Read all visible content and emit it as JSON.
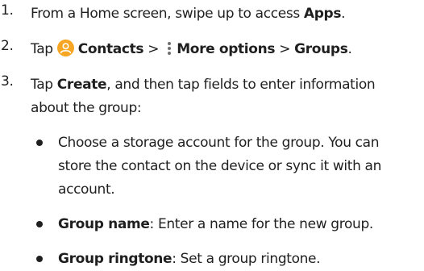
{
  "steps": [
    {
      "number": "1.",
      "lines": [
        {
          "a": "From a Home screen, swipe up to access ",
          "b": "Apps",
          "c": "."
        }
      ]
    },
    {
      "number": "2.",
      "tap": "Tap",
      "contacts_label": "Contacts",
      "sep1": " > ",
      "more_label": "More options",
      "sep2": " > ",
      "groups_label": "Groups",
      "end": "."
    },
    {
      "number": "3.",
      "line1_a": "Tap ",
      "line1_b": "Create",
      "line1_c": ", and then tap fields to enter information",
      "line2": "about the group:"
    }
  ],
  "bullets": [
    {
      "lines": [
        "Choose a storage account for the group. You can",
        "store the contact on the device or sync it with an",
        "account."
      ]
    },
    {
      "bold": "Group name",
      "text": ": Enter a name for the new group."
    },
    {
      "bold": "Group ringtone",
      "text": ": Set a group ringtone."
    }
  ],
  "icons": {
    "contacts": {
      "name": "contacts-app-icon",
      "color": "#f6a623"
    },
    "more": {
      "name": "more-options-icon",
      "color": "#707070"
    }
  }
}
